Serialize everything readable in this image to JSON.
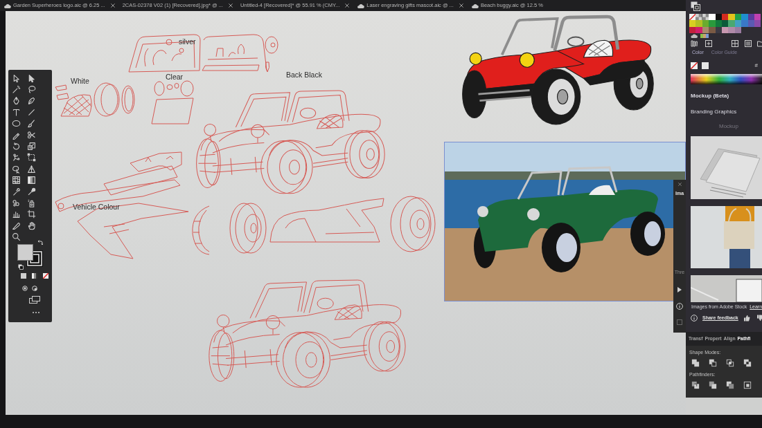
{
  "document_tabs": [
    {
      "label": "Garden Superheroes logo.aic @ 6.25 ...",
      "kind": "cloud"
    },
    {
      "label": "2CAS-02378 V02 (1) [Recovered].jpg* @ ...",
      "kind": "local"
    },
    {
      "label": "Untitled-4 [Recovered]* @ 55.91 % (CMY...",
      "kind": "local"
    },
    {
      "label": "Laser engraving gifts mascot.aic @ ...",
      "kind": "cloud"
    },
    {
      "label": "Beach buggy.aic @ 12.5 %",
      "kind": "cloud"
    }
  ],
  "artboard": {
    "labels": [
      "silver",
      "White",
      "Clear",
      "Back Black",
      "Vehicle Colour"
    ]
  },
  "swatches_panel": {
    "swatches": [
      {
        "kind": "none"
      },
      {
        "kind": "pattern"
      },
      {
        "kind": "pattern"
      },
      {
        "kind": "color",
        "color": "#ffffff"
      },
      {
        "kind": "color",
        "color": "#111111"
      },
      {
        "kind": "color",
        "color": "#d42a20"
      },
      {
        "kind": "color",
        "color": "#e3c41c"
      },
      {
        "kind": "color",
        "color": "#21a04a"
      },
      {
        "kind": "color",
        "color": "#1f8fd0"
      },
      {
        "kind": "color",
        "color": "#5a3c9c"
      },
      {
        "kind": "color",
        "color": "#c040b0"
      },
      {
        "kind": "color",
        "color": "#d8cf22"
      },
      {
        "kind": "color",
        "color": "#b2c024"
      },
      {
        "kind": "color",
        "color": "#6aac2e"
      },
      {
        "kind": "color",
        "color": "#2a9a3c"
      },
      {
        "kind": "color",
        "color": "#127a3c"
      },
      {
        "kind": "color",
        "color": "#0b5a3a"
      },
      {
        "kind": "color",
        "color": "#4aa870"
      },
      {
        "kind": "color",
        "color": "#42a0c2"
      },
      {
        "kind": "color",
        "color": "#3a78c8"
      },
      {
        "kind": "color",
        "color": "#5a5ab2"
      },
      {
        "kind": "color",
        "color": "#8a4aa8"
      },
      {
        "kind": "color",
        "color": "#c2203c"
      },
      {
        "kind": "color",
        "color": "#d01f6a"
      },
      {
        "kind": "color",
        "color": "#a88a6a"
      },
      {
        "kind": "color",
        "color": "#7a5a44"
      },
      {
        "kind": "color",
        "color": "#3c3a44"
      },
      {
        "kind": "color",
        "color": "#c898b0"
      },
      {
        "kind": "color",
        "color": "#b08aa8"
      },
      {
        "kind": "color",
        "color": "#9a7aa0"
      }
    ]
  },
  "color_panel": {
    "tabs": [
      {
        "label": "Color",
        "selected": true
      },
      {
        "label": "Color Guide",
        "selected": false
      }
    ],
    "hex_label": "#"
  },
  "mockup_panel": {
    "title": "Mockup (Beta)",
    "category": "Branding Graphics",
    "heading": "Mockup",
    "source_text": "Images from Adobe Stock",
    "learn_link": "Learn",
    "feedback_link": "Share feedback"
  },
  "side_panel": {
    "label": "Ima",
    "label_2": "Thre"
  },
  "pathfinder_panel": {
    "tabs": [
      {
        "label": "Transf",
        "selected": false
      },
      {
        "label": "Propert",
        "selected": false
      },
      {
        "label": "Align",
        "selected": false
      },
      {
        "label": "Pathfi",
        "selected": true
      }
    ],
    "sections": [
      {
        "title": "Shape Modes:"
      },
      {
        "title": "Pathfinders:"
      }
    ]
  }
}
